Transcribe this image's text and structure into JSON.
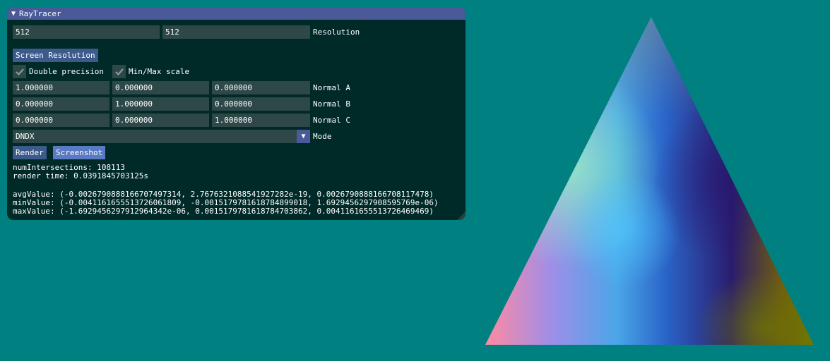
{
  "window": {
    "title": "RayTracer",
    "collapse_arrow": "▼",
    "resolution": {
      "width": "512",
      "height": "512",
      "label": "Resolution"
    },
    "screen_resolution_button": "Screen Resolution",
    "double_precision": {
      "label": "Double precision",
      "checked": true
    },
    "minmax_scale": {
      "label": "Min/Max scale",
      "checked": true
    },
    "normal_a": {
      "values": [
        "1.000000",
        "0.000000",
        "0.000000"
      ],
      "label": "Normal A"
    },
    "normal_b": {
      "values": [
        "0.000000",
        "1.000000",
        "0.000000"
      ],
      "label": "Normal B"
    },
    "normal_c": {
      "values": [
        "0.000000",
        "0.000000",
        "1.000000"
      ],
      "label": "Normal C"
    },
    "mode": {
      "value": "DNDX",
      "label": "Mode",
      "arrow": "▼"
    },
    "render_button": "Render",
    "screenshot_button": "Screenshot",
    "stats": {
      "num_intersections": "numIntersections: 108113",
      "render_time": "render time: 0.0391845703125s",
      "avg_value": "avgValue: (-0.00267908881667074973​14, 2.7676321088541927282e-19, 0.0026790888166708117478)",
      "min_value": "minValue: (-0.0041161655513726061809, -0.0015179781618784899018, 1.6929456297908595769e-06)",
      "max_value": "maxValue: (-1.6929456297912964342e-06, 0.0015179781618784703862, 0.0041161655513726469469)"
    }
  },
  "colors": {
    "background": "#008080",
    "window_bg": "#002a28",
    "titlebar": "#4a5a99",
    "field_bg": "#2e4848",
    "button": "#3c5a8c",
    "button_active": "#5a7ac4"
  },
  "icons": {
    "check": "check-icon",
    "collapse": "triangle-down-icon",
    "combo": "chevron-down-icon"
  }
}
